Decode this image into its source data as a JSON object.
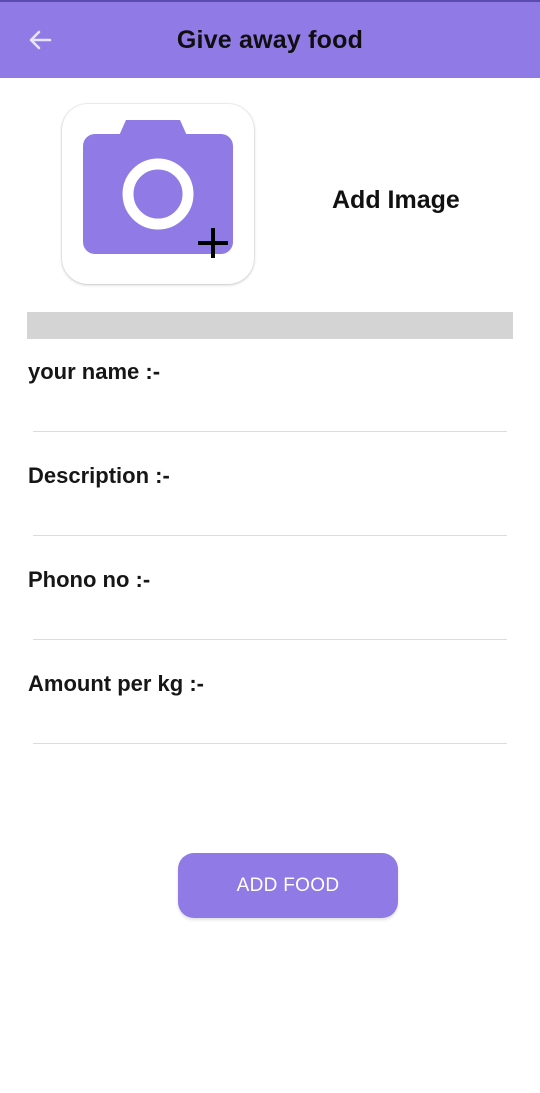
{
  "appbar": {
    "title": "Give away food",
    "back_icon": "arrow-left-icon",
    "background": "#8f7ae6"
  },
  "image_picker": {
    "icon": "add-photo-camera-icon",
    "label": "Add Image",
    "icon_color": "#8f7ae6"
  },
  "form": {
    "fields": [
      {
        "label": "your name :-",
        "value": ""
      },
      {
        "label": "Description :-",
        "value": ""
      },
      {
        "label": "Phono no :-",
        "value": ""
      },
      {
        "label": "Amount per kg :-",
        "value": ""
      }
    ]
  },
  "submit": {
    "label": "ADD FOOD",
    "color": "#8f7ae6"
  }
}
